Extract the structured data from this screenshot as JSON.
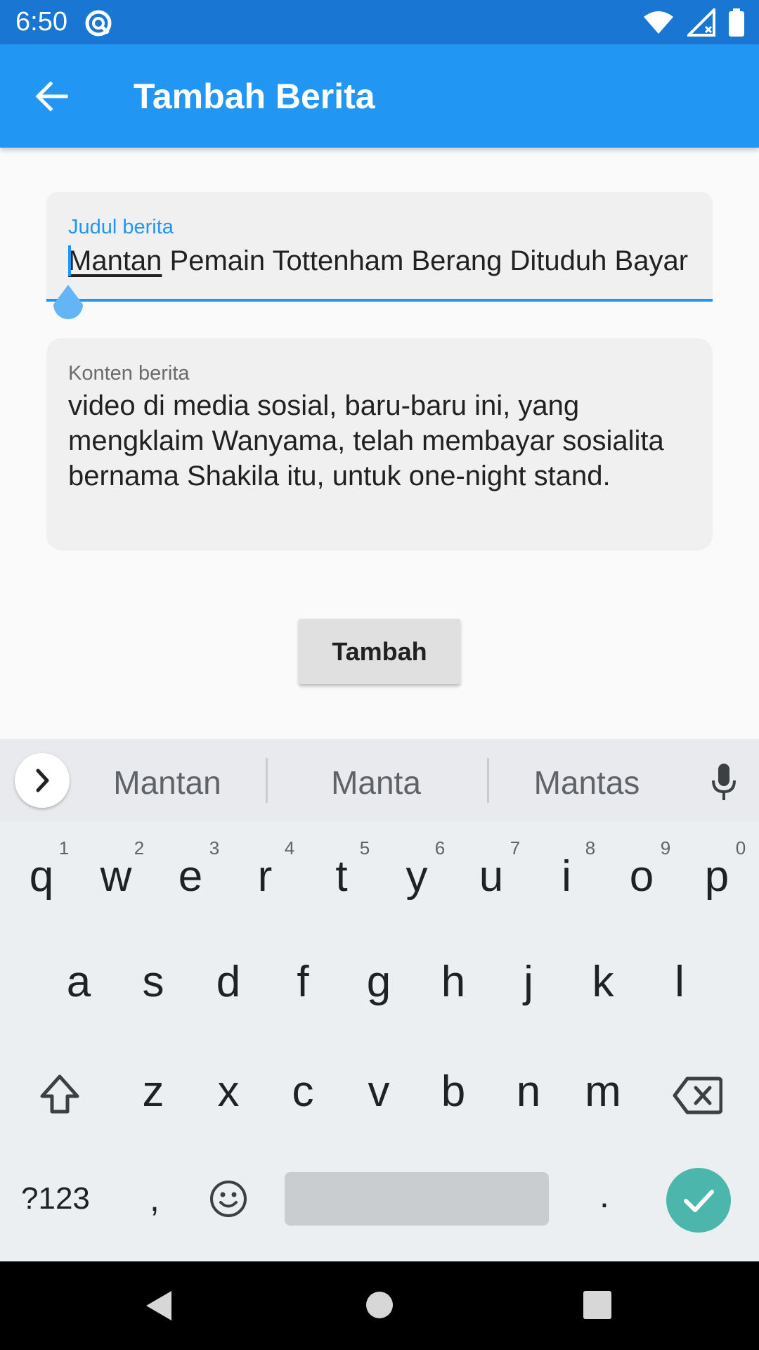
{
  "status_bar": {
    "time": "6:50"
  },
  "app_bar": {
    "title": "Tambah Berita"
  },
  "form": {
    "title_field": {
      "label": "Judul berita",
      "value_word": "Mantan",
      "value_rest": " Pemain Tottenham Berang Dituduh Bayar"
    },
    "content_field": {
      "label": "Konten berita",
      "value": "video di media sosial, baru-baru ini, yang mengklaim Wanyama, telah membayar sosialita bernama Shakila itu, untuk one-night stand."
    },
    "submit_label": "Tambah"
  },
  "keyboard": {
    "suggestions": [
      "Mantan",
      "Manta",
      "Mantas"
    ],
    "row1": [
      "q",
      "w",
      "e",
      "r",
      "t",
      "y",
      "u",
      "i",
      "o",
      "p"
    ],
    "row1_hints": [
      "1",
      "2",
      "3",
      "4",
      "5",
      "6",
      "7",
      "8",
      "9",
      "0"
    ],
    "row2": [
      "a",
      "s",
      "d",
      "f",
      "g",
      "h",
      "j",
      "k",
      "l"
    ],
    "row3": [
      "z",
      "x",
      "c",
      "v",
      "b",
      "n",
      "m"
    ],
    "symbols_label": "?123",
    "comma": ",",
    "period": "."
  },
  "colors": {
    "status_bar": "#1976D2",
    "app_bar": "#2196F3",
    "accent": "#2196F3",
    "enter_key": "#4DB6AC"
  },
  "icons": [
    "wifi-icon",
    "signal-icon",
    "battery-icon",
    "app-notification-icon",
    "back-arrow-icon",
    "chevron-right-icon",
    "mic-icon",
    "shift-icon",
    "backspace-icon",
    "emoji-icon",
    "check-icon",
    "nav-back-icon",
    "nav-home-icon",
    "nav-recents-icon"
  ]
}
